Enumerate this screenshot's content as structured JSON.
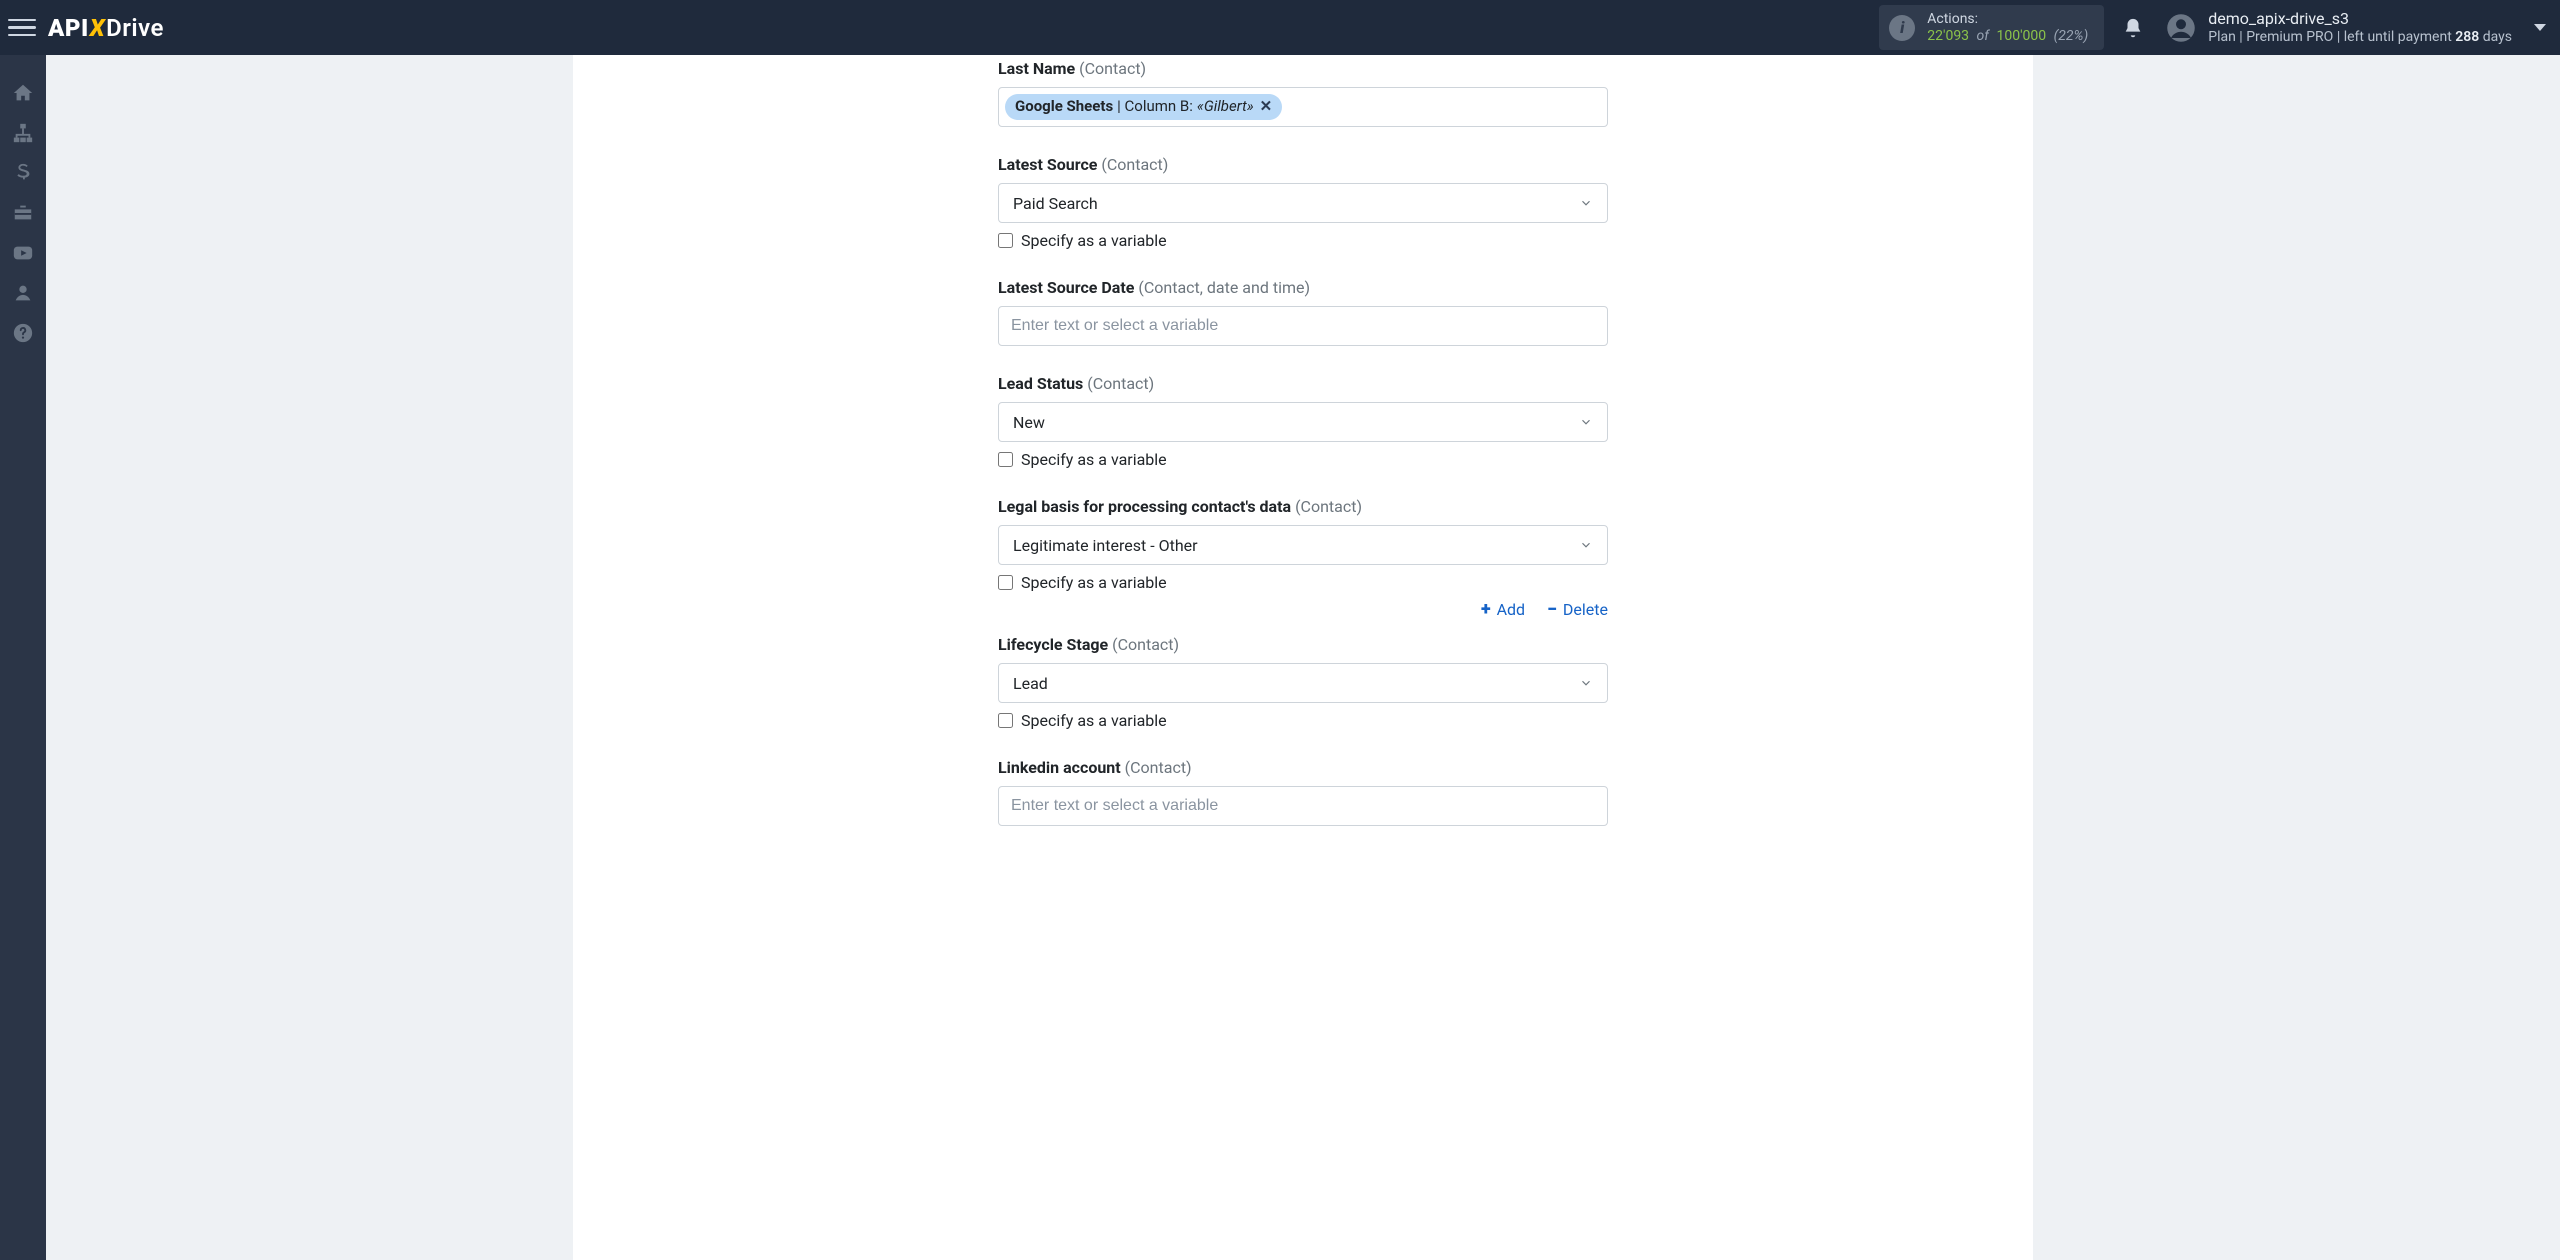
{
  "brand": {
    "part1": "API",
    "part2": "X",
    "part3": "Drive"
  },
  "header": {
    "actions_label": "Actions:",
    "actions_used": "22'093",
    "actions_of": "of",
    "actions_total": "100'000",
    "actions_pct": "(22%)",
    "user_name": "demo_apix-drive_s3",
    "plan_prefix": "Plan |",
    "plan_name": "Premium PRO",
    "plan_middle": "| left until payment ",
    "plan_days_bold": "288",
    "plan_suffix": " days"
  },
  "sidebar_icons": [
    "home",
    "sitemap",
    "dollar",
    "briefcase",
    "youtube",
    "user",
    "question"
  ],
  "form": {
    "input_placeholder": "Enter text or select a variable",
    "specify_variable": "Specify as a variable",
    "add_label": "Add",
    "delete_label": "Delete",
    "last_name": {
      "label": "Last Name",
      "hint": "(Contact)",
      "tag_source": "Google Sheets",
      "tag_sep": " | Column B: ",
      "tag_value": "«Gilbert»"
    },
    "latest_source": {
      "label": "Latest Source",
      "hint": "(Contact)",
      "value": "Paid Search"
    },
    "latest_source_date": {
      "label": "Latest Source Date",
      "hint": "(Contact, date and time)"
    },
    "lead_status": {
      "label": "Lead Status",
      "hint": "(Contact)",
      "value": "New"
    },
    "legal_basis": {
      "label": "Legal basis for processing contact's data",
      "hint": "(Contact)",
      "value": "Legitimate interest - Other"
    },
    "lifecycle_stage": {
      "label": "Lifecycle Stage",
      "hint": "(Contact)",
      "value": "Lead"
    },
    "linkedin": {
      "label": "Linkedin account",
      "hint": "(Contact)"
    }
  }
}
